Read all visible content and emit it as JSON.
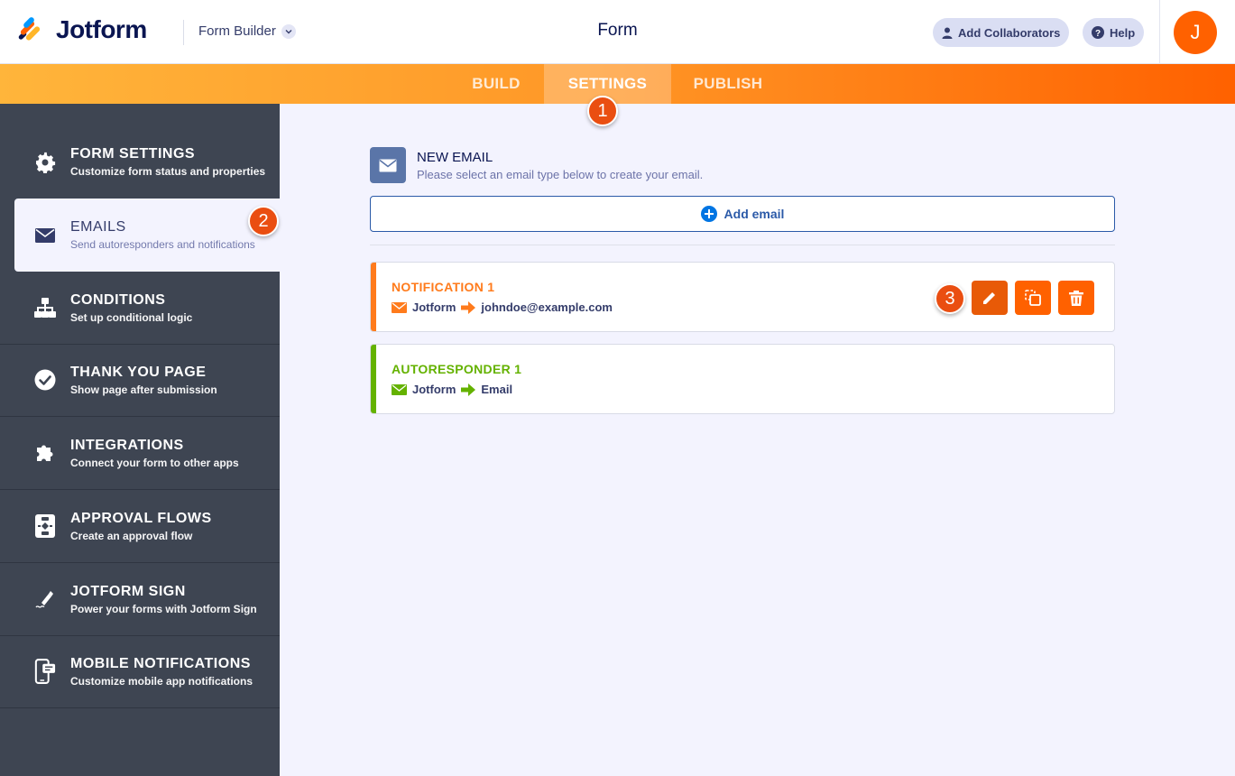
{
  "header": {
    "brand": "Jotform",
    "builder_label": "Form Builder",
    "form_title": "Form",
    "collaborators_label": "Add Collaborators",
    "help_label": "Help",
    "avatar_letter": "J"
  },
  "tabs": [
    {
      "label": "BUILD"
    },
    {
      "label": "SETTINGS"
    },
    {
      "label": "PUBLISH"
    }
  ],
  "badges": [
    "1",
    "2",
    "3"
  ],
  "sidebar": {
    "items": [
      {
        "title": "FORM SETTINGS",
        "subtitle": "Customize form status and properties",
        "icon": "gear-icon"
      },
      {
        "title": "EMAILS",
        "subtitle": "Send autoresponders and notifications",
        "icon": "envelope-icon"
      },
      {
        "title": "CONDITIONS",
        "subtitle": "Set up conditional logic",
        "icon": "sitemap-icon"
      },
      {
        "title": "THANK YOU PAGE",
        "subtitle": "Show page after submission",
        "icon": "check-circle-icon"
      },
      {
        "title": "INTEGRATIONS",
        "subtitle": "Connect your form to other apps",
        "icon": "puzzle-icon"
      },
      {
        "title": "APPROVAL FLOWS",
        "subtitle": "Create an approval flow",
        "icon": "flow-icon"
      },
      {
        "title": "JOTFORM SIGN",
        "subtitle": "Power your forms with Jotform Sign",
        "icon": "pen-icon"
      },
      {
        "title": "MOBILE NOTIFICATIONS",
        "subtitle": "Customize mobile app notifications",
        "icon": "mobile-icon"
      }
    ]
  },
  "main": {
    "new_email_title": "NEW EMAIL",
    "new_email_subtitle": "Please select an email type below to create your email.",
    "add_email_label": "Add email",
    "emails": [
      {
        "title": "NOTIFICATION 1",
        "from": "Jotform",
        "to": "johndoe@example.com",
        "color": "#ff7b1c"
      },
      {
        "title": "AUTORESPONDER 1",
        "from": "Jotform",
        "to": "Email",
        "color": "#64b200"
      }
    ]
  },
  "colors": {
    "accent": "#ff6100",
    "sidebar": "#3e4552",
    "notification": "#ff7b1c",
    "autoresponder": "#64b200",
    "link": "#2b5aa8"
  }
}
